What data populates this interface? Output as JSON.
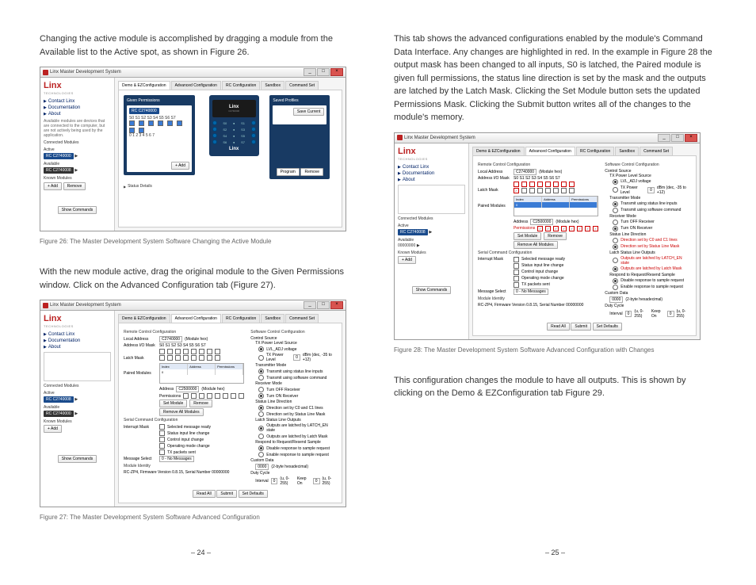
{
  "left": {
    "para1": "Changing the active module is accomplished by dragging a module from the Available list to the Active spot, as shown in Figure 26.",
    "fig26_caption": "Figure 26: The Master Development System Software Changing the Active Module",
    "para2": "With the new module active, drag the original module to the Given Permissions window. Click on the Advanced Configuration tab (Figure 27).",
    "fig27_caption": "Figure 27: The Master Development System Software Advanced Configuration",
    "pagenum": "– 24 –"
  },
  "right": {
    "para1": "This tab shows the advanced configurations enabled by the module's Command Data Interface. Any changes are highlighted in red. In the example in Figure 28 the output mask has been changed to all inputs, S0 is latched, the Paired module is given full permissions, the status line direction is set by the mask and the outputs are latched by the Latch Mask. Clicking the Set Module button sets the updated Permissions Mask. Clicking the Submit button writes all of the changes to the module's memory.",
    "fig28_caption": "Figure 28: The Master Development System Software Advanced Configuration with Changes",
    "para2": "This configuration changes the module to have all outputs. This is shown by clicking on the Demo & EZConfiguration tab Figure 29.",
    "pagenum": "– 25 –"
  },
  "app": {
    "title": "Linx Master Development System",
    "logo": "Linx",
    "logo_sub": "TECHNOLOGIES",
    "sidebar_links": {
      "contact": "Contact Linx",
      "docs": "Documentation",
      "about": "About"
    },
    "sidebar_note": "Available modules are devices that are connected to the computer, but are not actively being used by the application.",
    "sidebar": {
      "connected": "Connected Modules",
      "active": "Active",
      "available": "Available",
      "known": "Known Modules",
      "addr1": "00000000",
      "chip1": "RC C2740000",
      "chip2": "RC C2740008",
      "addbtn": "+ Add",
      "rembtn": "Remove",
      "showcmd": "Show Commands"
    },
    "tabs": {
      "t1": "Demo & EZConfiguration",
      "t2": "Advanced Configuration",
      "t3": "RC Configuration",
      "t4": "Sandbox",
      "t5": "Command Set"
    },
    "demo": {
      "given_perms": "Given Permissions",
      "saved_profiles": "Saved Profiles",
      "save_current": "Save Current",
      "addbtn": "+ Add",
      "program": "Program",
      "remove": "Remove",
      "status": "Status Details",
      "stat_nums_top": "S0 S1 S2 S3 S4 S5 S6 S7",
      "stat_nums_bot": "0 1 2 3 4 5 6 7",
      "module_part": "C2740000",
      "pins": [
        "S0",
        "S1",
        "S2",
        "S3",
        "S4",
        "S5",
        "S6",
        "S7"
      ]
    },
    "adv": {
      "remote_title": "Remote Control Configuration",
      "local_addr_lbl": "Local Address",
      "local_addr_val": "C2740000",
      "module_hex": "(Module hex)",
      "addr_mask_lbl": "Address I/O Mask",
      "latch_mask_lbl": "Latch Mask",
      "stat_head": "S0 S1 S2 S3 S4 S5 S6 S7",
      "paired_lbl": "Paired Modules",
      "pt_head": {
        "idx": "Index",
        "addr": "Address",
        "perm": "Permissions"
      },
      "pt_row0_idx": "0",
      "paired_addr_lbl": "Address",
      "paired_addr_val": "C2500000",
      "perms_lbl": "Permissions",
      "set_module": "Set Module",
      "adv_remove": "Remove",
      "remove_all": "Remove All Modules",
      "serial_title": "Serial Command Configuration",
      "interrupt_lbl": "Interrupt Mask",
      "int1": "Selected message ready",
      "int2": "Status input line change",
      "int3": "Control input change",
      "int4": "Operating mode change",
      "int5": "TX packets sent",
      "msg_select_lbl": "Message Select",
      "msg_select_val": "0 - No Messages",
      "module_identity_lbl": "Module Identity",
      "module_identity_val": "RC-ZP4, Firmware Version 0.8.15, Serial Number 00000000",
      "sw_title": "Software Control Configuration",
      "ctrl_source_lbl": "Control Source",
      "txpls_lbl": "TX Power Level Source",
      "txpls_opt": "LVL_ADJ voltage",
      "txpl_lbl": "TX Power Level",
      "txpl_val": "0",
      "txpl_note": "dBm (dec, -35 to +12)",
      "tx_mode_lbl": "Transmitter Mode",
      "tx_opt1": "Transmit using status line inputs",
      "tx_opt2": "Transmit using software command",
      "rx_mode_lbl": "Receiver Mode",
      "rx_opt1": "Turn OFF Receiver",
      "rx_opt2": "Turn ON Receiver",
      "sld_lbl": "Status Line Direction",
      "sld_opt1": "Direction set by C0 and C1 lines",
      "sld_opt2": "Direction set by Status Line Mask",
      "lslo_lbl": "Latch Status Line Outputs",
      "lslo_opt1": "Outputs are latched by LATCH_EN state",
      "lslo_opt2": "Outputs are latched by Latch Mask",
      "rrs_lbl": "Respond to Request/Resend Sample",
      "rrs_opt1": "Disable response to sample request",
      "rrs_opt2": "Enable response to sample request",
      "custom_lbl": "Custom Data",
      "custom_val": "0000",
      "custom_note": "(2-byte hexadecimal)",
      "duty_lbl": "Duty Cycle",
      "interval_lbl": "Interval",
      "interval_val": "0",
      "interval_note": "(u, 0-255)",
      "keepon_lbl": "Keep On",
      "keepon_val": "0",
      "read_all": "Read All",
      "submit": "Submit",
      "set_defaults": "Set Defaults"
    }
  }
}
